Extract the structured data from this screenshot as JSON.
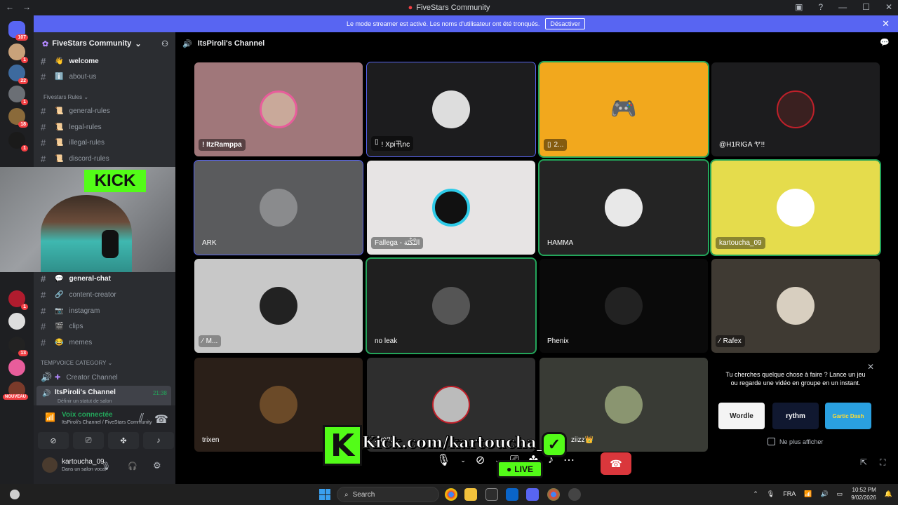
{
  "window": {
    "title": "FiveStars Community"
  },
  "banner": {
    "text": "Le mode streamer est activé. Les noms d'utilisateur ont été tronqués.",
    "button": "Désactiver"
  },
  "servers": [
    {
      "badge": "107"
    },
    {
      "badge": "1"
    },
    {
      "badge": "22"
    },
    {
      "badge": "1"
    },
    {
      "badge": "18"
    },
    {
      "badge": "1"
    },
    {
      "badge": "1"
    },
    {
      "badge": "13"
    },
    {
      "badge": "NOUVEAU"
    }
  ],
  "sidebar": {
    "server_name": "FiveStars Community",
    "channels_top": [
      {
        "emoji": "👋",
        "name": "welcome",
        "bold": true
      },
      {
        "emoji": "ℹ️",
        "name": "about-us",
        "bold": false
      }
    ],
    "rules_category": "Fivestars Rules",
    "rules_channels": [
      {
        "emoji": "📜",
        "name": "general-rules"
      },
      {
        "emoji": "📜",
        "name": "legal-rules"
      },
      {
        "emoji": "📜",
        "name": "illegal-rules"
      },
      {
        "emoji": "📜",
        "name": "discord-rules"
      }
    ],
    "channels_bottom": [
      {
        "emoji": "💬",
        "name": "general-chat",
        "bold": true
      },
      {
        "emoji": "🔗",
        "name": "content-creator",
        "bold": false
      },
      {
        "emoji": "📷",
        "name": "instagram",
        "bold": false
      },
      {
        "emoji": "🎬",
        "name": "clips",
        "bold": false
      },
      {
        "emoji": "😂",
        "name": "memes",
        "bold": false
      }
    ],
    "temp_category": "TEMPVOICE CATEGORY",
    "creator_channel": "Creator Channel",
    "active_voice": {
      "name": "ItsPiroli's Channel",
      "timer": "21:38",
      "status": "Définir un statut de salon"
    }
  },
  "voice_panel": {
    "connected": "Voix connectée",
    "location": "ItsPiroli's Channel / FiveStars Community",
    "user": "kartoucha_09",
    "user_status": "Dans un salon vocal"
  },
  "main": {
    "channel_title": "ItsPiroli's Channel",
    "tiles": [
      {
        "name": "! ItzRamppa"
      },
      {
        "name": "! Xpi卂nc"
      },
      {
        "name": "2..."
      },
      {
        "name": "@H1RIGA ヤ!!"
      },
      {
        "name": "ARK"
      },
      {
        "name": "Fallega - التَّكْتَة"
      },
      {
        "name": "HAMMA"
      },
      {
        "name": "kartoucha_09"
      },
      {
        "name": "M..."
      },
      {
        "name": "no leak"
      },
      {
        "name": "Phenix"
      },
      {
        "name": "Rafex"
      },
      {
        "name": "trixen"
      },
      {
        "name": "...cYU"
      },
      {
        "name": "ziizz👑"
      }
    ],
    "invite": {
      "text": "Tu cherches quelque chose à faire ? Lance un jeu ou regarde une vidéo en groupe en un instant.",
      "activities": [
        "Wordle",
        "rythm",
        "Gartic Dash"
      ],
      "checkbox": "Ne plus afficher"
    }
  },
  "overlay": {
    "kick_url": "Kick.com/kartoucha_09",
    "live": "LIVE",
    "kick_logo": "KICK"
  },
  "taskbar": {
    "search": "Search",
    "lang": "FRA",
    "time": "10:52 PM",
    "date": "9/02/2026"
  }
}
